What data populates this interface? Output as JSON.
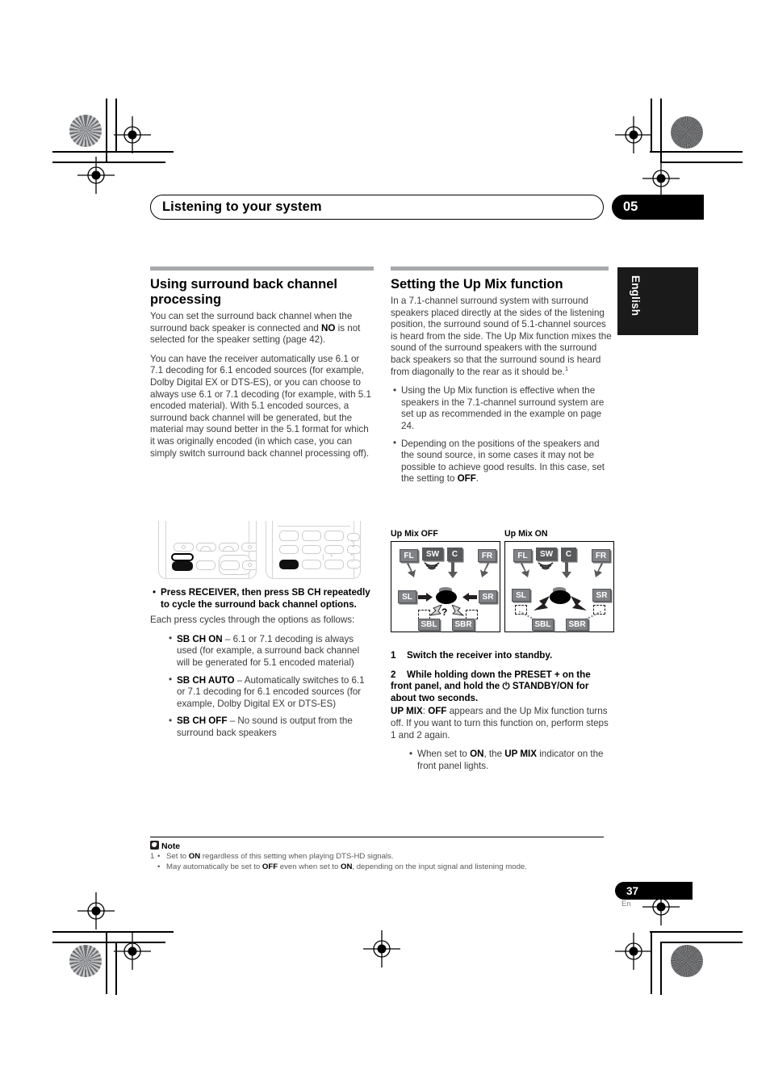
{
  "header": {
    "title": "Listening to your system",
    "chapter": "05"
  },
  "side_tab": {
    "language": "English"
  },
  "left_column": {
    "heading": "Using surround back channel processing",
    "para1_a": "You can set the surround back channel when the surround back speaker is connected and ",
    "para1_b": "NO",
    "para1_c": " is not selected for the speaker setting (page 42).",
    "para2": "You can have the receiver automatically use 6.1 or 7.1 decoding for 6.1 encoded sources (for example, Dolby Digital EX or DTS-ES), or you can choose to always use 6.1 or 7.1 decoding (for example, with 5.1 encoded material). With 5.1 encoded sources, a surround back channel will be generated, but the material may sound better in the 5.1 format for which it was originally encoded (in which case, you can simply switch surround back channel processing off).",
    "instruction": "Press RECEIVER, then press SB CH repeatedly to cycle the surround back channel options.",
    "instruction_follow": "Each press cycles through the options as follows:",
    "options": [
      {
        "term": "SB CH ON",
        "desc": " – 6.1 or 7.1 decoding is always used (for example, a surround back channel will be generated for 5.1 encoded material)"
      },
      {
        "term": "SB CH AUTO",
        "desc": " – Automatically switches to 6.1 or 7.1 decoding for 6.1 encoded sources (for example, Dolby Digital EX or DTS-ES)"
      },
      {
        "term": "SB CH OFF",
        "desc": " – No sound is output from the surround back speakers"
      }
    ]
  },
  "right_column": {
    "heading": "Setting the Up Mix function",
    "para1": "In a 7.1-channel surround system with surround speakers placed directly at the sides of the listening position, the surround sound of 5.1-channel sources is heard from the side. The Up Mix function mixes the sound of the surround speakers with the surround back speakers so that the surround sound is heard from diagonally to the rear as it should be.",
    "para1_footnote": "1",
    "bullets": [
      "Using the Up Mix function is effective when the speakers in the 7.1-channel surround system are set up as recommended in the example on page 24.",
      "Depending on the positions of the speakers and the sound source, in some cases it may not be possible to achieve good results. In this case, set the setting to "
    ],
    "bullet2_bold": "OFF",
    "bullet2_end": ".",
    "steps": [
      {
        "num": "1",
        "text": "Switch the receiver into standby."
      },
      {
        "num": "2",
        "text_a": "While holding down the PRESET + on the front panel, and hold the ",
        "power_icon": "⏻",
        "text_b": " STANDBY/ON for about two seconds."
      }
    ],
    "step2_result_a": "UP MIX",
    "step2_result_b": ": ",
    "step2_result_c": "OFF",
    "step2_result_d": " appears and the Up Mix function turns off. If you want to turn this function on, perform steps 1 and 2 again.",
    "step2_bullet_a": "When set to ",
    "step2_bullet_b": "ON",
    "step2_bullet_c": ", the ",
    "step2_bullet_d": "UP MIX",
    "step2_bullet_e": " indicator on the front panel lights."
  },
  "diagrams": [
    {
      "caption": "Up Mix OFF",
      "speakers": [
        "FL",
        "SW",
        "C",
        "FR",
        "SL",
        "SR",
        "SBL",
        "SBR"
      ],
      "question_mark": "?"
    },
    {
      "caption": "Up Mix ON",
      "speakers": [
        "FL",
        "SW",
        "C",
        "FR",
        "SL",
        "SR",
        "SBL",
        "SBR"
      ]
    }
  ],
  "footnote": {
    "title": "Note",
    "index": "1",
    "lines": [
      {
        "a": "Set to ",
        "b": "ON",
        "c": " regardless of this setting when playing DTS-HD signals.",
        "indexed": true
      },
      {
        "a": "May automatically be set to ",
        "b": "OFF",
        "c": " even when set to ",
        "d": "ON",
        "e": ", depending on the input signal and listening mode.",
        "indexed": false
      }
    ]
  },
  "page_footer": {
    "number": "37",
    "language_code": "En"
  },
  "colors": {
    "rule_gray": "#a7a9ac",
    "speaker_gray": "#808285",
    "body_text": "#3b3b3b",
    "black": "#000000"
  }
}
